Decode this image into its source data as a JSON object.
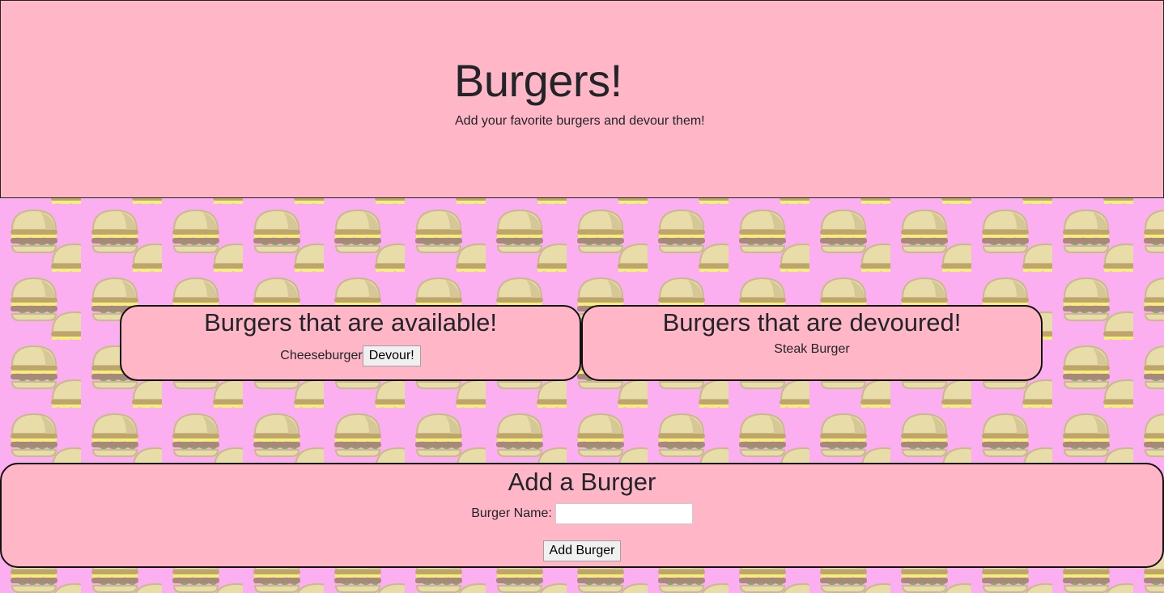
{
  "header": {
    "title": "Burgers!",
    "subtitle": "Add your favorite burgers and devour them!"
  },
  "available": {
    "heading": "Burgers that are available!",
    "items": [
      {
        "name": "Cheeseburger",
        "button_label": "Devour!"
      }
    ]
  },
  "devoured": {
    "heading": "Burgers that are devoured!",
    "items": [
      {
        "name": "Steak Burger"
      }
    ]
  },
  "add_form": {
    "heading": "Add a Burger",
    "name_label": "Burger Name:",
    "name_value": "",
    "submit_label": "Add Burger"
  },
  "colors": {
    "panel_bg": "#ffb6c6",
    "page_bg": "#fbaef0"
  },
  "background_icon": "burger-pattern"
}
